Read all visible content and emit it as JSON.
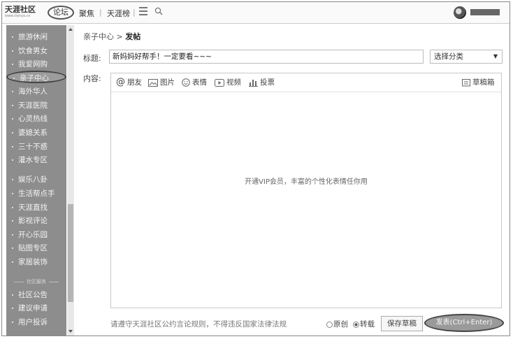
{
  "top_nav": {
    "logo_text": "天涯社区",
    "logo_url": "www.tianya.cn",
    "forum": "论坛",
    "focus": "聚焦",
    "separator": "|",
    "rank": "天涯榜"
  },
  "sidebar": {
    "group1": [
      "旅游休闲",
      "饮食男女",
      "我爱网购",
      "亲子中心",
      "海外华人",
      "天涯医院",
      "心灵热线",
      "婆媳关系",
      "三十不惑",
      "灌水专区"
    ],
    "group2": [
      "娱乐八卦",
      "生活帮点手",
      "天涯直找",
      "影视评论",
      "开心乐园",
      "贴图专区",
      "家居装饰"
    ],
    "section_label": "社区服务",
    "group3": [
      "社区公告",
      "建议申请",
      "用户投诉"
    ],
    "active_index": 3
  },
  "breadcrumb": {
    "parent": "亲子中心",
    "separator": ">",
    "current": "发帖"
  },
  "form": {
    "title_label": "标题:",
    "title_value": "新妈妈好帮手！一定要看~~~",
    "category": "选择分类",
    "content_label": "内容:"
  },
  "toolbar": {
    "mention": "朋友",
    "image": "图片",
    "emoji": "表情",
    "video": "视频",
    "vote": "投票",
    "drafts": "草稿箱"
  },
  "editor": {
    "vip_hint": "开通VIP会员，丰富的个性化表情任你用"
  },
  "footer": {
    "rules": "请遵守天涯社区公约言论规则，不得违反国家法律法规",
    "original": "原创",
    "repost": "转载",
    "save_draft": "保存草稿",
    "submit": "发表(Ctrl+Enter)"
  }
}
